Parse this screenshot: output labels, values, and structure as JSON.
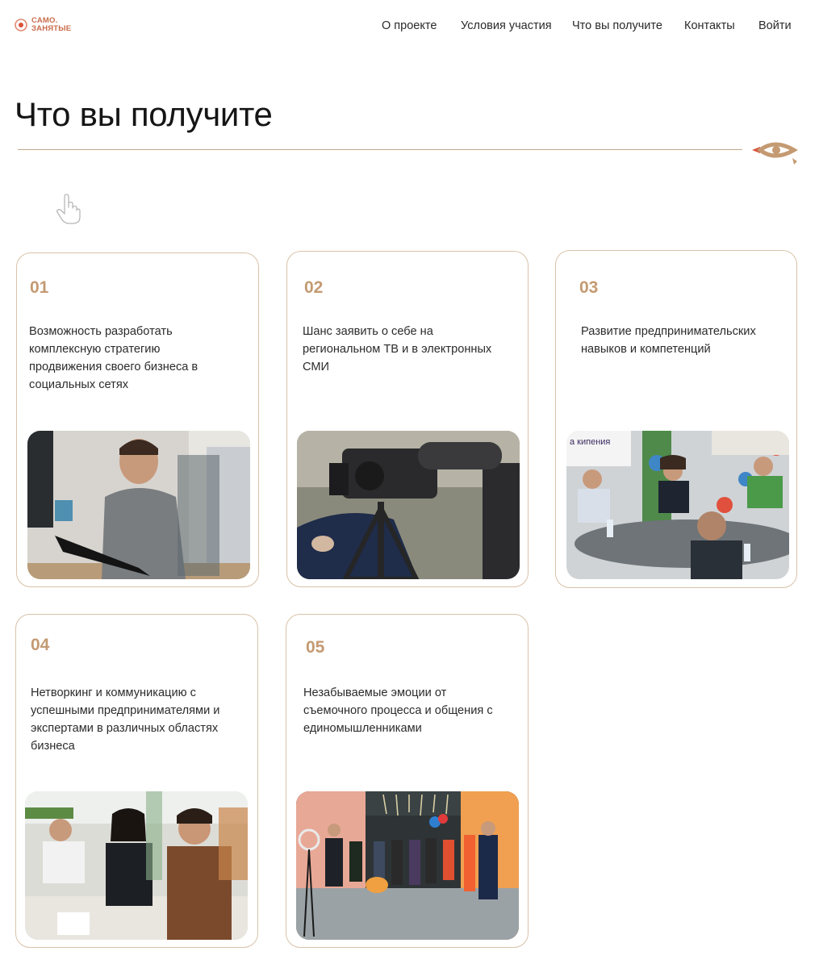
{
  "header": {
    "logo": {
      "line1": "САМО.",
      "line2": "ЗАНЯТЫЕ"
    },
    "nav": [
      {
        "label": "О проекте"
      },
      {
        "label": "Условия участия"
      },
      {
        "label": "Что вы получите"
      },
      {
        "label": "Контакты"
      },
      {
        "label": "Войти"
      }
    ]
  },
  "section": {
    "title": "Что вы получите"
  },
  "cards": [
    {
      "number": "01",
      "text": "Возможность разработать комплексную стратегию продвижения своего бизнеса в социальных сетях",
      "photo_icon": "laptop-man-photo"
    },
    {
      "number": "02",
      "text": "Шанс заявить о себе на региональном ТВ и в электронных СМИ",
      "photo_icon": "tv-camera-photo"
    },
    {
      "number": "03",
      "text": "Развитие предпринимательских навыков и компетенций",
      "photo_icon": "meeting-table-photo",
      "photo_caption": "а кипения"
    },
    {
      "number": "04",
      "text": "Нетворкинг и коммуникацию с успешными предпринимателями и экспертами в различных областях бизнеса",
      "photo_icon": "networking-photo"
    },
    {
      "number": "05",
      "text": "Незабываемые эмоции от съемочного процесса и общения с единомышленниками",
      "photo_icon": "studio-event-photo"
    }
  ],
  "colors": {
    "accent_brown": "#c49a72",
    "border": "#d9c2a9",
    "logo_red": "#c96b4b",
    "emblem_red": "#d9533a"
  }
}
